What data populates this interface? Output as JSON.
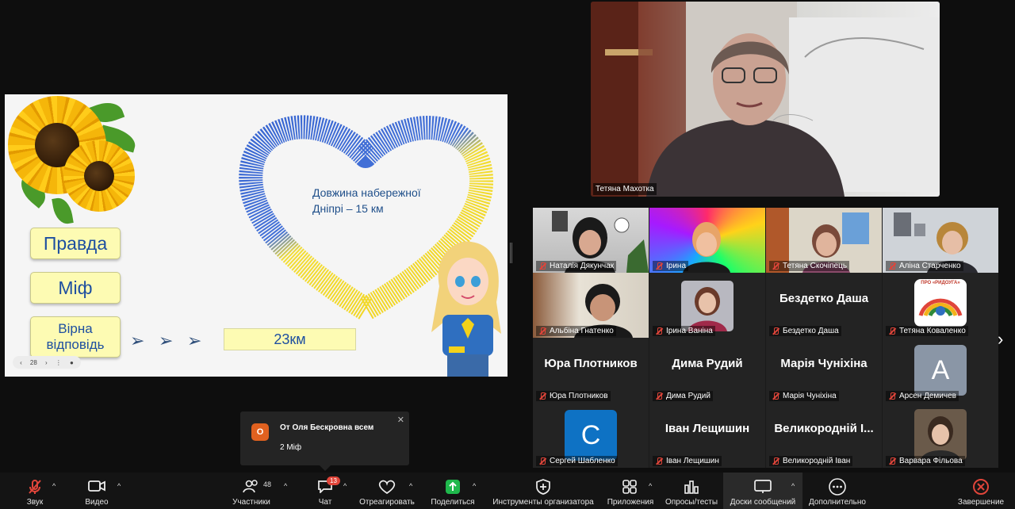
{
  "slide": {
    "buttons": [
      "Правда",
      "Міф",
      "Вірна відповідь"
    ],
    "heart_text_line1": "Довжина набережної",
    "heart_text_line2": "Дніпрі – 15 км",
    "answer": "23км",
    "arrow_glyph": "➢",
    "page_number": "28"
  },
  "speaker": {
    "name": "Тетяна Махотка"
  },
  "gallery": {
    "tiles": [
      {
        "name": "Наталія Дякунчак"
      },
      {
        "name": "Ірина"
      },
      {
        "name": "Тетяна Скочіпець"
      },
      {
        "name": "Аліна Старченко"
      },
      {
        "name": "Альбіна Гнатенко"
      },
      {
        "name": "Ірина Ваніна"
      },
      {
        "name": "Бездетко Даша",
        "display": "Бездетко Даша"
      },
      {
        "name": "Тетяна Коваленко"
      },
      {
        "name": "Юра Плотников",
        "display": "Юра Плотников"
      },
      {
        "name": "Дима Рудий",
        "display": "Дима Рудий"
      },
      {
        "name": "Марія Чуніхіна",
        "display": "Марія Чуніхіна"
      },
      {
        "name": "Арсен Демичев",
        "avatar_letter": "A"
      },
      {
        "name": "Сергей Шабленко",
        "avatar_letter": "C"
      },
      {
        "name": "Іван Лещишин",
        "display": "Іван Лещишин"
      },
      {
        "name": "Великородній Іван",
        "display": "Великородній І..."
      },
      {
        "name": "Варвара Фільова"
      }
    ],
    "logo_text": "ПРО «РИДОУГА»"
  },
  "toast": {
    "avatar_letter": "О",
    "from": "От Оля Бескровна всем",
    "message": "2 Міф",
    "close": "✕"
  },
  "toolbar": {
    "audio": "Звук",
    "video": "Видео",
    "participants": "Участники",
    "participants_count": "48",
    "chat": "Чат",
    "chat_badge": "13",
    "react": "Отреагировать",
    "share": "Поделиться",
    "host_tools": "Инструменты организатора",
    "apps": "Приложения",
    "polls": "Опросы/тесты",
    "whiteboards": "Доски сообщений",
    "more": "Дополнительно",
    "end": "Завершение"
  },
  "colors": {
    "accent_green": "#1fb84c",
    "end_red": "#e0453a",
    "badge_red": "#e0453a"
  }
}
